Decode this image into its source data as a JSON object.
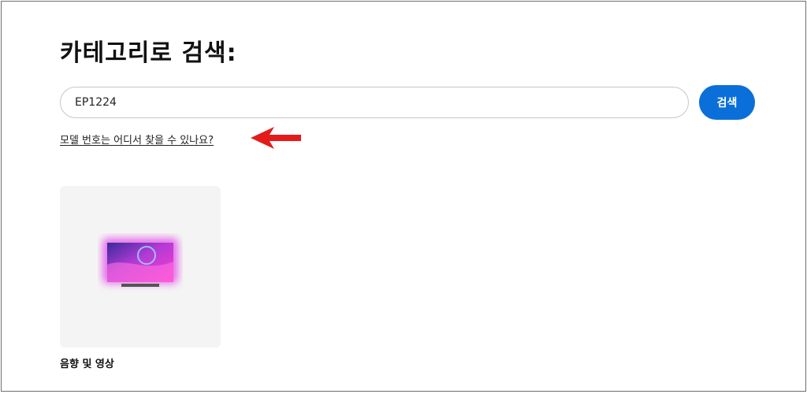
{
  "page": {
    "title": "카테고리로 검색:"
  },
  "search": {
    "value": "EP1224",
    "button_label": "검색"
  },
  "help": {
    "link_text": "모델 번호는 어디서 찾을 수 있나요?"
  },
  "annotation": {
    "arrow_color": "#e31b1b"
  },
  "categories": [
    {
      "label": "음향 및 영상",
      "icon": "tv-icon"
    }
  ],
  "colors": {
    "accent": "#0b6fd9",
    "card_background": "#f4f4f4",
    "input_border": "#c7c7c7"
  }
}
